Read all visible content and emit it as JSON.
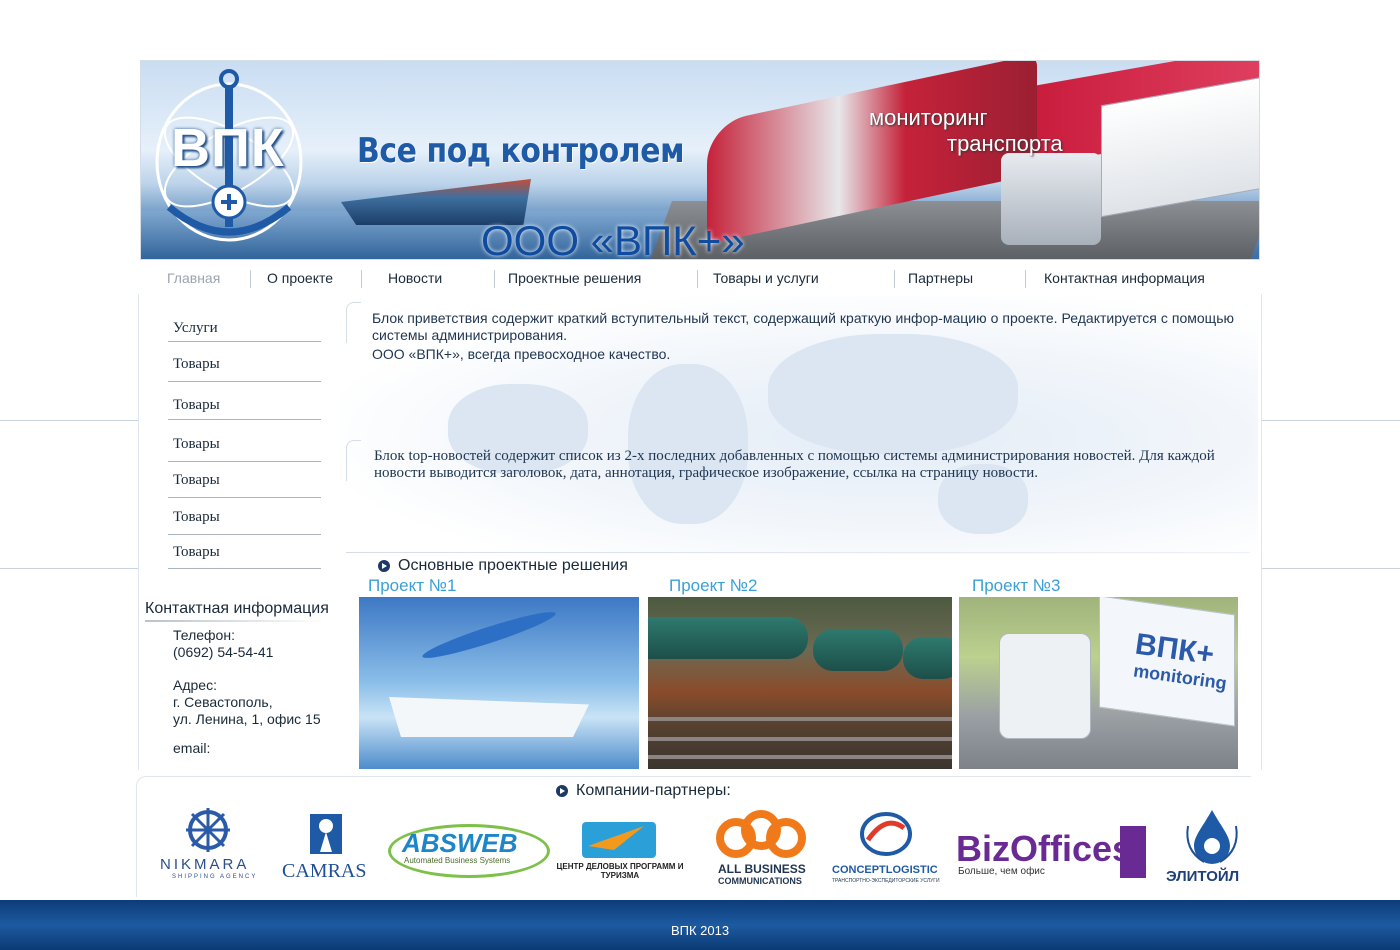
{
  "banner": {
    "logo_text": "ВПК",
    "slogan": "Все под контролем",
    "company_name": "ООО «ВПК+»",
    "monitoring_line1": "мониторинг",
    "monitoring_line2": "транспорта"
  },
  "nav": {
    "items": [
      {
        "label": "Главная",
        "active": true
      },
      {
        "label": "О проекте"
      },
      {
        "label": "Новости"
      },
      {
        "label": "Проектные решения"
      },
      {
        "label": "Товары и услуги"
      },
      {
        "label": "Партнеры"
      },
      {
        "label": "Контактная информация"
      }
    ]
  },
  "sidebar": {
    "items": [
      {
        "label": "Услуги"
      },
      {
        "label": "Товары"
      },
      {
        "label": "Товары"
      },
      {
        "label": "Товары"
      },
      {
        "label": "Товары"
      },
      {
        "label": "Товары"
      },
      {
        "label": "Товары"
      }
    ]
  },
  "contact": {
    "title": "Контактная информация",
    "phone_label": "Телефон:",
    "phone": "(0692) 54-54-41",
    "address_label": "Адрес:",
    "city": "г. Севастополь,",
    "street": "ул. Ленина, 1, офис 15",
    "email_label": "email:"
  },
  "main": {
    "welcome_text": "Блок приветствия содержит краткий вступительный текст, содержащий краткую инфор-мацию о проекте. Редактируется с помощью системы администрирования.",
    "welcome_text2": "ООО «ВПК+», всегда превосходное качество.",
    "topnews_text": "Блок top-новостей содержит список из 2-х последних добавленных с помощью системы администрирования новостей. Для каждой новости  выводится заголовок, дата, аннотация, графическое изображение, ссылка на страницу новости.",
    "projects_title": "Основные проектные решения",
    "projects": [
      {
        "title": "Проект №1"
      },
      {
        "title": "Проект №2"
      },
      {
        "title": "Проект №3"
      }
    ],
    "truck_logo_line1": "ВПК+",
    "truck_logo_line2": "monitoring"
  },
  "partners": {
    "title": "Компании-партнеры:",
    "logos": [
      {
        "name": "NIKMARA",
        "sub": "SHIPPING AGENCY"
      },
      {
        "name": "CAMRAS"
      },
      {
        "name": "ABSWEB",
        "sub": "Automated Business Systems"
      },
      {
        "name": "ЦЕНТР ДЕЛОВЫХ ПРОГРАММ И ТУРИЗМА"
      },
      {
        "name": "ALL BUSINESS",
        "sub": "COMMUNICATIONS"
      },
      {
        "name": "CONCEPTLOGISTIC",
        "sub": "ТРАНСПОРТНО-ЭКСПЕДИТОРСКИЕ УСЛУГИ"
      },
      {
        "name": "BizOffices",
        "sub": "Больше, чем офис"
      },
      {
        "name": "ЭЛИТОЙЛ"
      }
    ]
  },
  "footer": {
    "text": "ВПК  2013"
  },
  "colors": {
    "accent_blue": "#3aa0d8",
    "footer_blue": "#0c3c78",
    "text_dark": "#1a2a3a"
  }
}
